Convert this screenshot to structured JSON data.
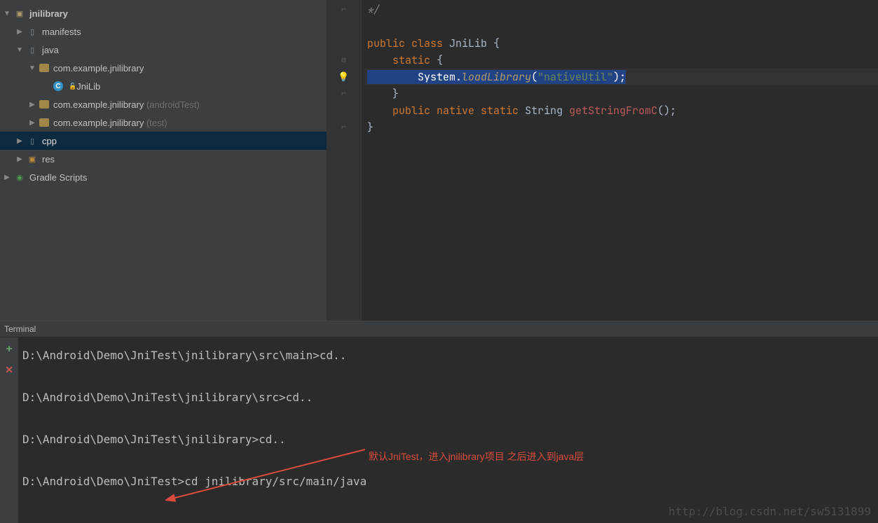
{
  "project": {
    "root": "jnilibrary",
    "items": {
      "manifests": "manifests",
      "java": "java",
      "pkg_main": "com.example.jnilibrary",
      "class_jnilib": "JniLib",
      "pkg_androidtest_base": "com.example.jnilibrary",
      "pkg_androidtest_suffix": " (androidTest)",
      "pkg_test_base": "com.example.jnilibrary",
      "pkg_test_suffix": " (test)",
      "cpp": "cpp",
      "res": "res",
      "gradle": "Gradle Scripts"
    }
  },
  "editor": {
    "l1": "*/",
    "l3_pre": "public class ",
    "l3_class": "JniLib",
    "l3_post": " {",
    "l4_pre": "    ",
    "l4_kw": "static",
    "l4_post": " {",
    "l5_pre": "        System.",
    "l5_method": "loadLibrary",
    "l5_paren_open": "(",
    "l5_string": "\"nativeUtil\"",
    "l5_paren_close": ");",
    "l6": "    }",
    "l7_pre": "    ",
    "l7_k1": "public",
    "l7_k2": " native",
    "l7_k3": " static",
    "l7_type": " String ",
    "l7_m": "getStringFromC",
    "l7_post": "();",
    "l8": "}"
  },
  "terminal": {
    "tab_title": "Terminal",
    "lines": {
      "l1": "D:\\Android\\Demo\\JniTest\\jnilibrary\\src\\main>cd..",
      "l2": "D:\\Android\\Demo\\JniTest\\jnilibrary\\src>cd..",
      "l3": "D:\\Android\\Demo\\JniTest\\jnilibrary>cd..",
      "l4": "D:\\Android\\Demo\\JniTest>cd jnilibrary/src/main/java"
    },
    "annotation": "默认JniTest，进入jnilibrary项目 之后进入到java层"
  },
  "watermark": "http://blog.csdn.net/sw5131899"
}
